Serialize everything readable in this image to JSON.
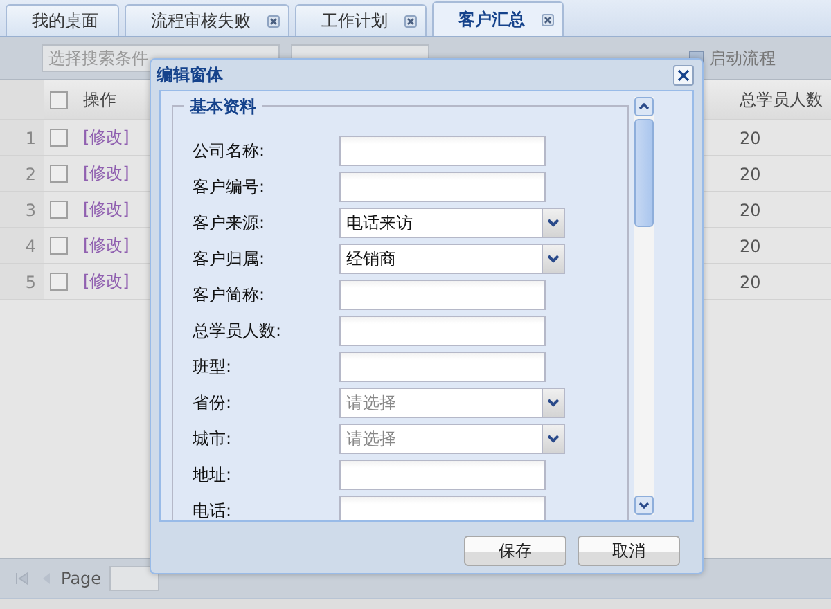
{
  "tabs": [
    {
      "label": "我的桌面",
      "closable": false,
      "selected": false
    },
    {
      "label": "流程审核失败",
      "closable": true,
      "selected": false
    },
    {
      "label": "工作计划",
      "closable": true,
      "selected": false
    },
    {
      "label": "客户汇总",
      "closable": true,
      "selected": true
    }
  ],
  "toolbar": {
    "search_placeholder": "选择搜索条件",
    "start_flow": "启动流程"
  },
  "grid": {
    "columns": [
      "操作",
      "总学员人数"
    ],
    "header_checked": false,
    "rows": [
      {
        "number": "1",
        "checked": false,
        "action": "[修改]",
        "total": "20"
      },
      {
        "number": "2",
        "checked": false,
        "action": "[修改]",
        "total": "20"
      },
      {
        "number": "3",
        "checked": false,
        "action": "[修改]",
        "total": "20"
      },
      {
        "number": "4",
        "checked": false,
        "action": "[修改]",
        "total": "20"
      },
      {
        "number": "5",
        "checked": false,
        "action": "[修改]",
        "total": "20"
      }
    ]
  },
  "pager": {
    "label": "Page"
  },
  "dialog": {
    "title": "编辑窗体",
    "section": "基本资料",
    "fields": [
      {
        "label": "公司名称:",
        "kind": "text"
      },
      {
        "label": "客户编号:",
        "kind": "text"
      },
      {
        "label": "客户来源:",
        "kind": "select",
        "value": "电话来访"
      },
      {
        "label": "客户归属:",
        "kind": "select",
        "value": "经销商"
      },
      {
        "label": "客户简称:",
        "kind": "text"
      },
      {
        "label": "总学员人数:",
        "kind": "text"
      },
      {
        "label": "班型:",
        "kind": "text"
      },
      {
        "label": "省份:",
        "kind": "select",
        "placeholder": "请选择"
      },
      {
        "label": "城市:",
        "kind": "select",
        "placeholder": "请选择"
      },
      {
        "label": "地址:",
        "kind": "text"
      },
      {
        "label": "电话:",
        "kind": "text"
      }
    ],
    "buttons": [
      "保存",
      "取消"
    ]
  }
}
